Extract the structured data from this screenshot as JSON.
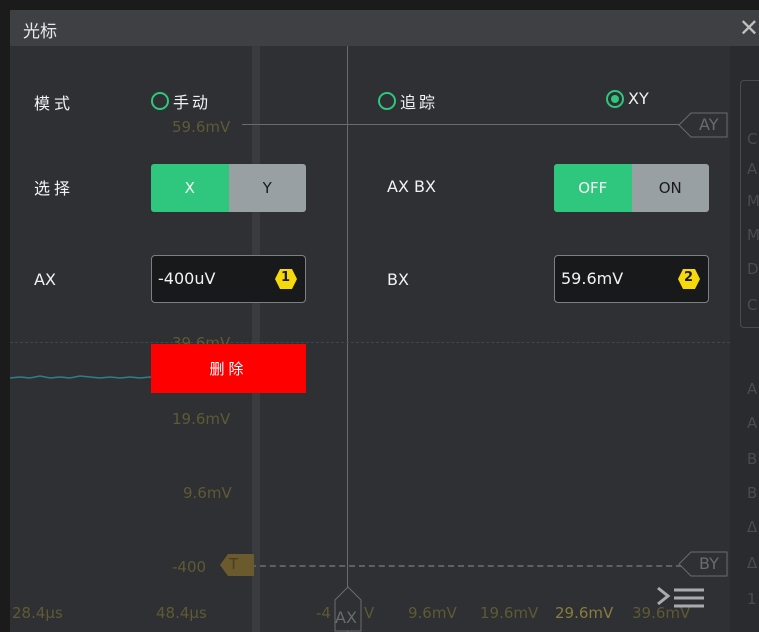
{
  "dialog": {
    "title": "光标",
    "close_glyph": "✕"
  },
  "mode": {
    "label": "模式",
    "options": [
      {
        "label": "手动",
        "selected": false
      },
      {
        "label": "追踪",
        "selected": false
      },
      {
        "label": "XY",
        "selected": true
      }
    ]
  },
  "select": {
    "label": "选择",
    "options": [
      "X",
      "Y"
    ],
    "active": "X"
  },
  "axbx": {
    "label": "AX BX",
    "options": [
      "OFF",
      "ON"
    ],
    "active": "OFF"
  },
  "ax": {
    "label": "AX",
    "value": "-400uV",
    "badge": "1"
  },
  "bx": {
    "label": "BX",
    "value": "59.6mV",
    "badge": "2"
  },
  "delete_label": "删除",
  "background": {
    "y_labels": [
      "59.6mV",
      "39.6mV",
      "19.6mV",
      "9.6mV",
      "-400"
    ],
    "x_labels": [
      "28.4µs",
      "48.4µs",
      "-4",
      "9.6mV",
      "19.6mV",
      "29.6mV",
      "39.6mV"
    ],
    "cursor_labels": {
      "ay": "AY",
      "by": "BY",
      "ax": "AX",
      "t": "T"
    },
    "ax_suffix": "V"
  },
  "right_strip_letters": [
    "C",
    "A",
    "M",
    "M",
    "D",
    "C",
    "A",
    "A",
    "B",
    "B",
    "Δ",
    "Δ",
    "1"
  ],
  "colors": {
    "accent": "#2fc67e",
    "delete": "#ff0000",
    "badge": "#f5d90a",
    "dim_text": "#5e5a34"
  }
}
